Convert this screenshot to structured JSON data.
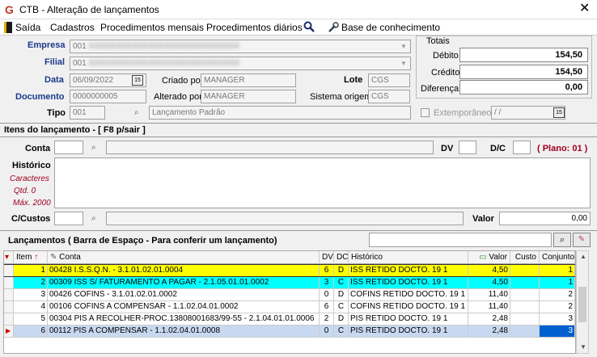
{
  "window": {
    "title": "CTB - Alteração de lançamentos",
    "close": "✕"
  },
  "menu": [
    {
      "label": "Saída"
    },
    {
      "label": "Cadastros"
    },
    {
      "label": "Procedimentos mensais"
    },
    {
      "label": "Procedimentos diários"
    },
    {
      "label": "Base de conhecimento"
    }
  ],
  "form": {
    "empresa_label": "Empresa",
    "empresa_code": "001",
    "empresa_name": "XXXXXXXXXXXXXXXXXXXXXXXXXXXX",
    "filial_label": "Filial",
    "filial_code": "001",
    "filial_name": "XXXXXXXXXXXXXXXXXXXXXXXXXXXX",
    "data_label": "Data",
    "data_value": "06/09/2022",
    "cal_icon": "15",
    "criado_label": "Criado por",
    "criado_value": "MANAGER",
    "lote_label": "Lote",
    "lote_value": "CGS",
    "documento_label": "Documento",
    "documento_value": "0000000005",
    "alterado_label": "Alterado por",
    "alterado_value": "MANAGER",
    "sistema_label": "Sistema origem",
    "sistema_value": "CGS",
    "tipo_label": "Tipo",
    "tipo_code": "001",
    "tipo_name": "Lançamento Padrão"
  },
  "totals": {
    "title": "Totais",
    "debito_label": "Débito",
    "debito_value": "154,50",
    "credito_label": "Crédito",
    "credito_value": "154,50",
    "diferenca_label": "Diferença",
    "diferenca_value": "0,00"
  },
  "extemporaneo": {
    "label": "Extemporâneo",
    "date": " / /",
    "cal_icon": "15"
  },
  "itens": {
    "header": "Itens do lançamento - [ F8 p/sair ]",
    "conta_label": "Conta",
    "dv_label": "DV",
    "dc_label": "D/C",
    "plano": "( Plano: 01 )",
    "historico_label": "Histórico",
    "caracteres": "Caracteres",
    "qtd": "Qtd. 0",
    "max": "Máx. 2000",
    "ccustos_label": "C/Custos",
    "valor_label": "Valor",
    "valor_value": "0,00"
  },
  "lancamentos": {
    "header": "Lançamentos ( Barra de Espaço - Para conferir um lançamento)",
    "columns": [
      "Item",
      "Conta",
      "DV",
      "DC",
      "Histórico",
      "Valor",
      "Custo",
      "Conjunto"
    ],
    "rows": [
      {
        "item": "1",
        "conta": "00428 I.S.S.Q.N. - 3.1.01.02.01.0004",
        "dv": "6",
        "dc": "D",
        "historico": "ISS RETIDO DOCTO. 19 1",
        "valor": "4,50",
        "custo": "",
        "conjunto": "1"
      },
      {
        "item": "2",
        "conta": "00309 ISS S/ FATURAMENTO A PAGAR - 2.1.05.01.01.0002",
        "dv": "3",
        "dc": "C",
        "historico": "ISS RETIDO DOCTO. 19 1",
        "valor": "4,50",
        "custo": "",
        "conjunto": "1"
      },
      {
        "item": "3",
        "conta": "00426 COFINS - 3.1.01.02.01.0002",
        "dv": "0",
        "dc": "D",
        "historico": "COFINS RETIDO DOCTO. 19 1",
        "valor": "11,40",
        "custo": "",
        "conjunto": "2"
      },
      {
        "item": "4",
        "conta": "00106 COFINS A COMPENSAR - 1.1.02.04.01.0002",
        "dv": "6",
        "dc": "C",
        "historico": "COFINS RETIDO DOCTO. 19 1",
        "valor": "11,40",
        "custo": "",
        "conjunto": "2"
      },
      {
        "item": "5",
        "conta": "00304 PIS A RECOLHER-PROC.13808001683/99-55 - 2.1.04.01.01.0006",
        "dv": "2",
        "dc": "D",
        "historico": "PIS RETIDO DOCTO. 19 1",
        "valor": "2,48",
        "custo": "",
        "conjunto": "3"
      },
      {
        "item": "6",
        "conta": "00112 PIS A COMPENSAR - 1.1.02.04.01.0008",
        "dv": "0",
        "dc": "C",
        "historico": "PIS RETIDO DOCTO. 19 1",
        "valor": "2,48",
        "custo": "",
        "conjunto": "3"
      }
    ]
  },
  "colors": {
    "yellow_row": "#ffff00",
    "cyan_row": "#00ffff",
    "selected_row": "#c8d8f0",
    "label_blue": "#1a3a8a",
    "label_red": "#a00020"
  }
}
